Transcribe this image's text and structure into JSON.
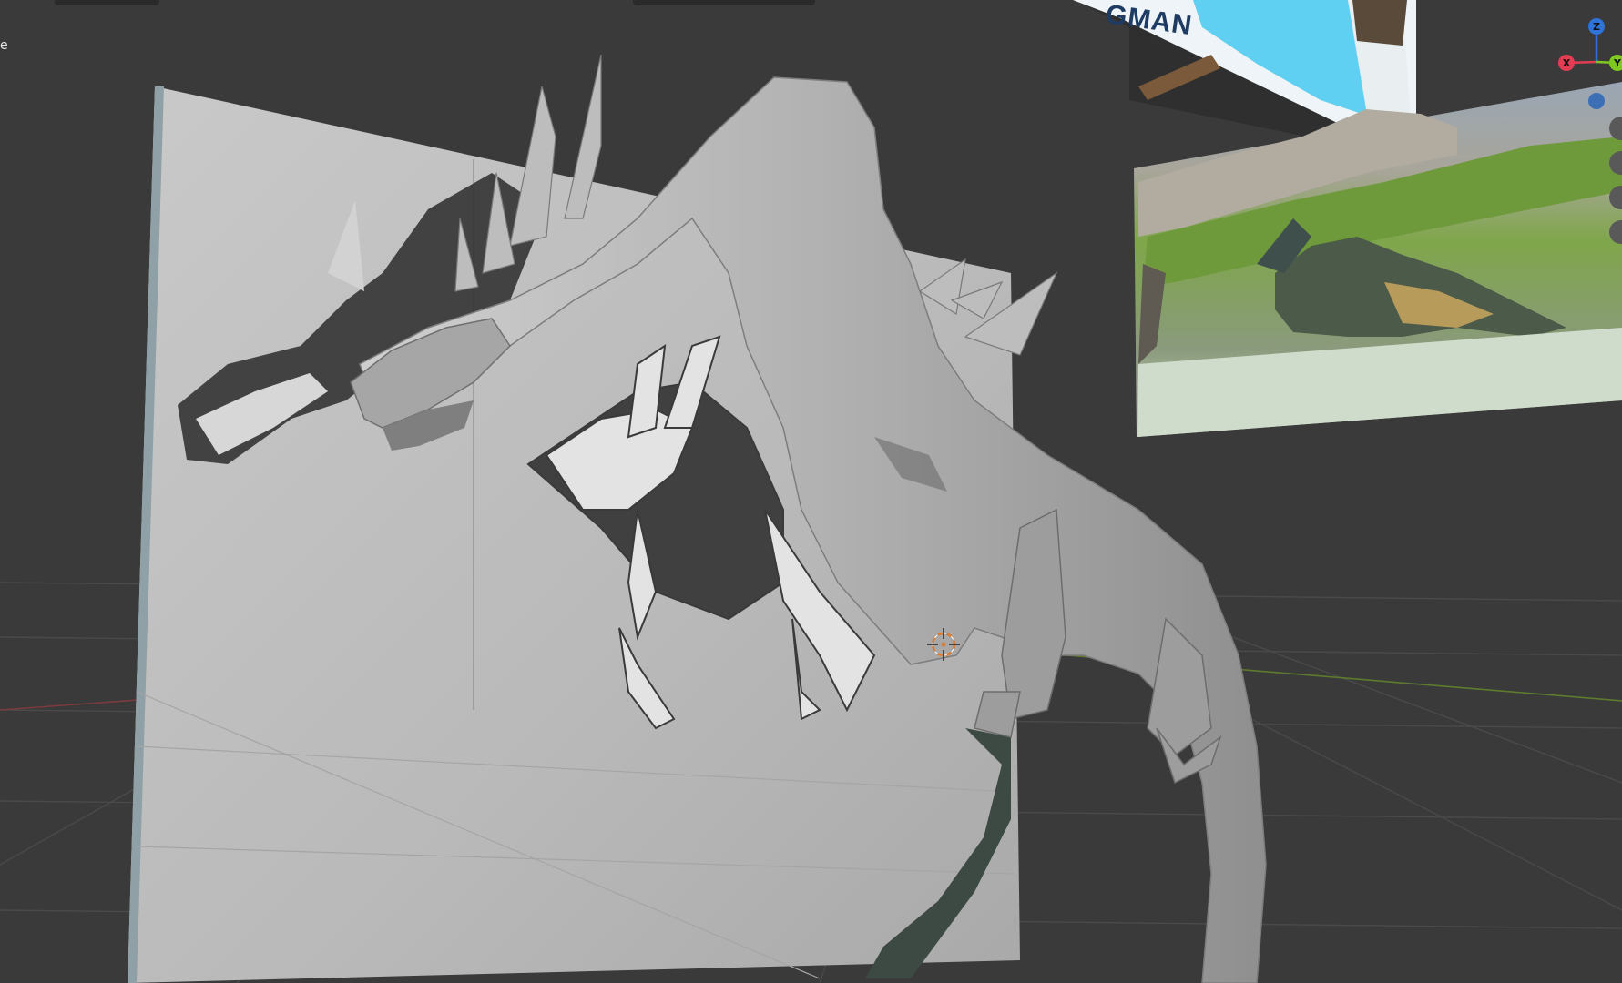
{
  "viewport": {
    "corner_label": "e",
    "reference_image_caption": "GMAN"
  },
  "navigation_gizmo": {
    "axes": [
      "Z",
      "X",
      "Y"
    ],
    "colors": {
      "x": "#e23d52",
      "y": "#7ec81f",
      "z": "#2f73d8",
      "view": "#3c6fb5"
    }
  },
  "colors": {
    "background": "#3a3a3a",
    "grid_line": "#4a4a4a",
    "x_axis_line": "#7a3a3f",
    "y_axis_line": "#5d7a2e",
    "mesh": "#b4b4b4",
    "reference_plane": "#bdbdbd",
    "reference_blue": "#5fcff2",
    "cursor": "#e07a2b"
  },
  "icons": [
    "3d-cursor-icon",
    "view-orbit-icon",
    "nav-gizmo"
  ]
}
